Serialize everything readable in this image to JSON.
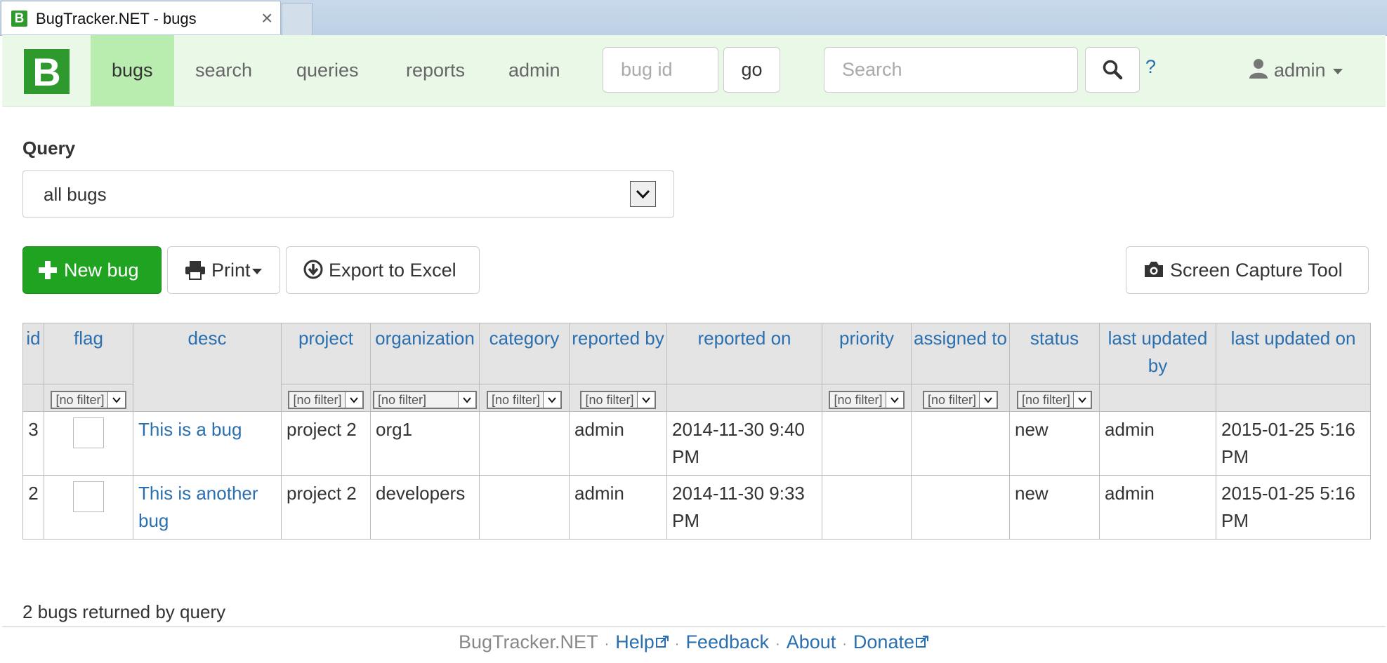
{
  "browser": {
    "tab_title": "BugTracker.NET - bugs",
    "tab_close": "×",
    "favicon_letter": "B"
  },
  "navbar": {
    "logo_letter": "B",
    "items": [
      {
        "label": "bugs",
        "active": true
      },
      {
        "label": "search"
      },
      {
        "label": "queries"
      },
      {
        "label": "reports"
      },
      {
        "label": "admin"
      }
    ],
    "bug_id_placeholder": "bug id",
    "go_label": "go",
    "search_placeholder": "Search",
    "help_label": "?",
    "user_label": "admin"
  },
  "query": {
    "label": "Query",
    "selected": "all bugs"
  },
  "toolbar": {
    "new_bug": "New bug",
    "print": "Print",
    "export": "Export to Excel",
    "capture": "Screen Capture Tool"
  },
  "table": {
    "headers": [
      "id",
      "flag",
      "desc",
      "project",
      "organization",
      "category",
      "reported by",
      "reported on",
      "priority",
      "assigned to",
      "status",
      "last updated by",
      "last updated on"
    ],
    "filter_label": "[no filter]",
    "rows": [
      {
        "id": "3",
        "desc": "This is a bug",
        "project": "project 2",
        "organization": "org1",
        "category": "",
        "reported_by": "admin",
        "reported_on": "2014-11-30 9:40 PM",
        "priority": "",
        "assigned_to": "",
        "status": "new",
        "last_updated_by": "admin",
        "last_updated_on": "2015-01-25 5:16 PM"
      },
      {
        "id": "2",
        "desc": "This is another bug",
        "project": "project 2",
        "organization": "developers",
        "category": "",
        "reported_by": "admin",
        "reported_on": "2014-11-30 9:33 PM",
        "priority": "",
        "assigned_to": "",
        "status": "new",
        "last_updated_by": "admin",
        "last_updated_on": "2015-01-25 5:16 PM"
      }
    ]
  },
  "result_count": "2 bugs returned by query",
  "footer": {
    "brand": "BugTracker.NET",
    "links": [
      "Help",
      "Feedback",
      "About",
      "Donate"
    ]
  },
  "colors": {
    "brand_green": "#2e9a2e",
    "navbar_bg": "#eaf8e8",
    "active_nav": "#b9ecaf",
    "link_blue": "#2a6fb0",
    "new_bug_green": "#20a320"
  }
}
